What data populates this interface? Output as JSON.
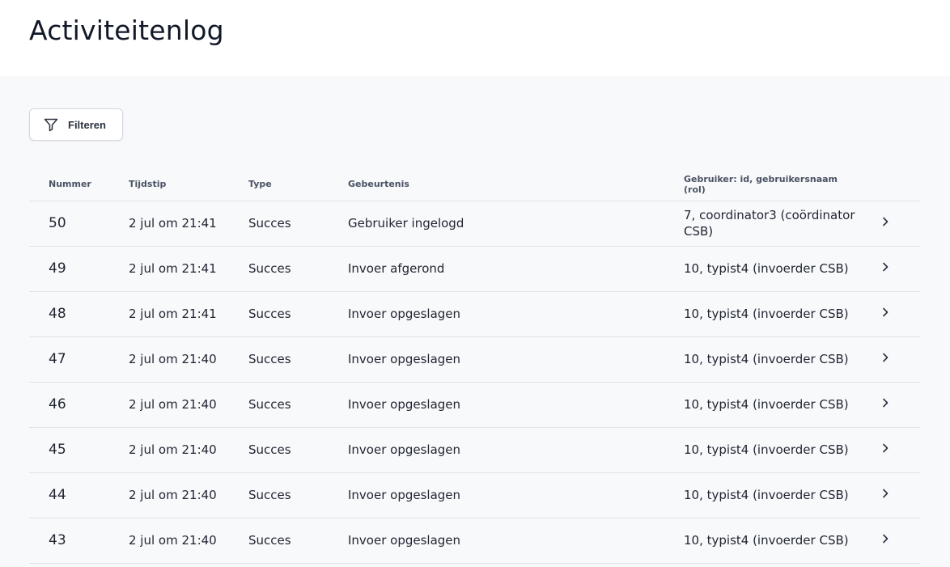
{
  "header": {
    "title": "Activiteitenlog"
  },
  "toolbar": {
    "filter_label": "Filteren"
  },
  "table": {
    "columns": {
      "nummer": "Nummer",
      "tijdstip": "Tijdstip",
      "type": "Type",
      "gebeurtenis": "Gebeurtenis",
      "gebruiker": "Gebruiker: id, gebruikersnaam (rol)"
    },
    "rows": [
      {
        "nummer": "50",
        "tijdstip": "2 jul om 21:41",
        "type": "Succes",
        "gebeurtenis": "Gebruiker ingelogd",
        "gebruiker": "7, coordinator3 (coördinator CSB)"
      },
      {
        "nummer": "49",
        "tijdstip": "2 jul om 21:41",
        "type": "Succes",
        "gebeurtenis": "Invoer afgerond",
        "gebruiker": "10, typist4 (invoerder CSB)"
      },
      {
        "nummer": "48",
        "tijdstip": "2 jul om 21:41",
        "type": "Succes",
        "gebeurtenis": "Invoer opgeslagen",
        "gebruiker": "10, typist4 (invoerder CSB)"
      },
      {
        "nummer": "47",
        "tijdstip": "2 jul om 21:40",
        "type": "Succes",
        "gebeurtenis": "Invoer opgeslagen",
        "gebruiker": "10, typist4 (invoerder CSB)"
      },
      {
        "nummer": "46",
        "tijdstip": "2 jul om 21:40",
        "type": "Succes",
        "gebeurtenis": "Invoer opgeslagen",
        "gebruiker": "10, typist4 (invoerder CSB)"
      },
      {
        "nummer": "45",
        "tijdstip": "2 jul om 21:40",
        "type": "Succes",
        "gebeurtenis": "Invoer opgeslagen",
        "gebruiker": "10, typist4 (invoerder CSB)"
      },
      {
        "nummer": "44",
        "tijdstip": "2 jul om 21:40",
        "type": "Succes",
        "gebeurtenis": "Invoer opgeslagen",
        "gebruiker": "10, typist4 (invoerder CSB)"
      },
      {
        "nummer": "43",
        "tijdstip": "2 jul om 21:40",
        "type": "Succes",
        "gebeurtenis": "Invoer opgeslagen",
        "gebruiker": "10, typist4 (invoerder CSB)"
      }
    ]
  },
  "icons": {
    "filter": "filter-icon",
    "row_arrow": "chevron-right-icon"
  },
  "colors": {
    "content_background": "#f8f9fb",
    "row_divider": "#dfe2e7",
    "text": "#1f2430"
  }
}
